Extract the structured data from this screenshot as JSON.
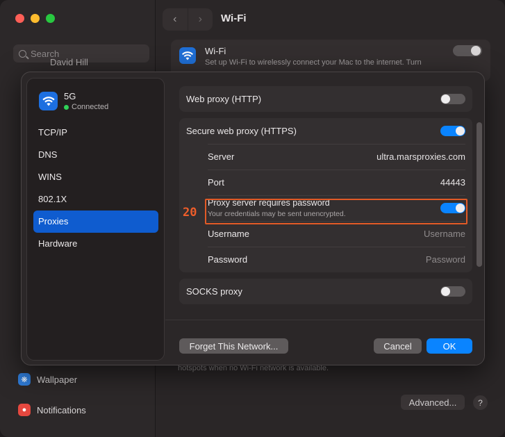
{
  "background": {
    "search_placeholder": "Search",
    "user_name": "David Hill",
    "title": "Wi-Fi",
    "wifi_card_title": "Wi-Fi",
    "wifi_card_desc": "Set up Wi-Fi to wirelessly connect your Mac to the internet. Turn",
    "hotspots_text": "hotspots when no Wi-Fi network is available.",
    "sidebar_items": [
      {
        "label": "Wallpaper",
        "icon": "wallpaper-icon",
        "color": "#2f7bd6"
      },
      {
        "label": "Notifications",
        "icon": "notifications-icon",
        "color": "#e5483f"
      }
    ],
    "advanced_label": "Advanced...",
    "help_label": "?"
  },
  "sheet": {
    "network": {
      "name": "5G",
      "status": "Connected"
    },
    "nav": [
      {
        "label": "TCP/IP",
        "active": false
      },
      {
        "label": "DNS",
        "active": false
      },
      {
        "label": "WINS",
        "active": false
      },
      {
        "label": "802.1X",
        "active": false
      },
      {
        "label": "Proxies",
        "active": true
      },
      {
        "label": "Hardware",
        "active": false
      }
    ],
    "web_proxy": {
      "label": "Web proxy (HTTP)",
      "enabled": false
    },
    "secure_proxy": {
      "label": "Secure web proxy (HTTPS)",
      "enabled": true,
      "server_label": "Server",
      "server_value": "ultra.marsproxies.com",
      "port_label": "Port",
      "port_value": "44443",
      "requires_password_label": "Proxy server requires password",
      "requires_password_sub": "Your credentials may be sent unencrypted.",
      "requires_password_enabled": true,
      "username_label": "Username",
      "username_placeholder": "Username",
      "password_label": "Password",
      "password_placeholder": "Password"
    },
    "socks_proxy": {
      "label": "SOCKS proxy",
      "enabled": false
    },
    "highlight_number": "20",
    "buttons": {
      "forget": "Forget This Network...",
      "cancel": "Cancel",
      "ok": "OK"
    }
  },
  "colors": {
    "accent": "#0a84ff",
    "highlight": "#e25a26",
    "status_green": "#30d158"
  }
}
